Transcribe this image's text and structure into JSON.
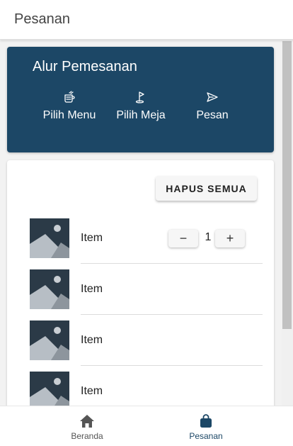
{
  "appbar": {
    "title": "Pesanan"
  },
  "flow": {
    "title": "Alur Pemesanan",
    "steps": [
      {
        "label": "Pilih Menu",
        "icon": "menu-food-icon"
      },
      {
        "label": "Pilih Meja",
        "icon": "golf-flag-icon"
      },
      {
        "label": "Pesan",
        "icon": "send-icon"
      }
    ]
  },
  "cart": {
    "clear_all_label": "HAPUS SEMUA",
    "items": [
      {
        "name": "Item",
        "quantity": "1",
        "decrement_symbol": "−",
        "increment_symbol": "+"
      },
      {
        "name": "Item"
      },
      {
        "name": "Item"
      },
      {
        "name": "Item"
      }
    ]
  },
  "nav": {
    "items": [
      {
        "label": "Beranda",
        "icon": "home-icon",
        "active": false
      },
      {
        "label": "Pesanan",
        "icon": "shopping-bag-icon",
        "active": true
      }
    ]
  },
  "colors": {
    "primary": "#1c4766",
    "nav_inactive": "#555555",
    "nav_active": "#1c4766",
    "thumbnail_bg": "#2b3a47"
  }
}
